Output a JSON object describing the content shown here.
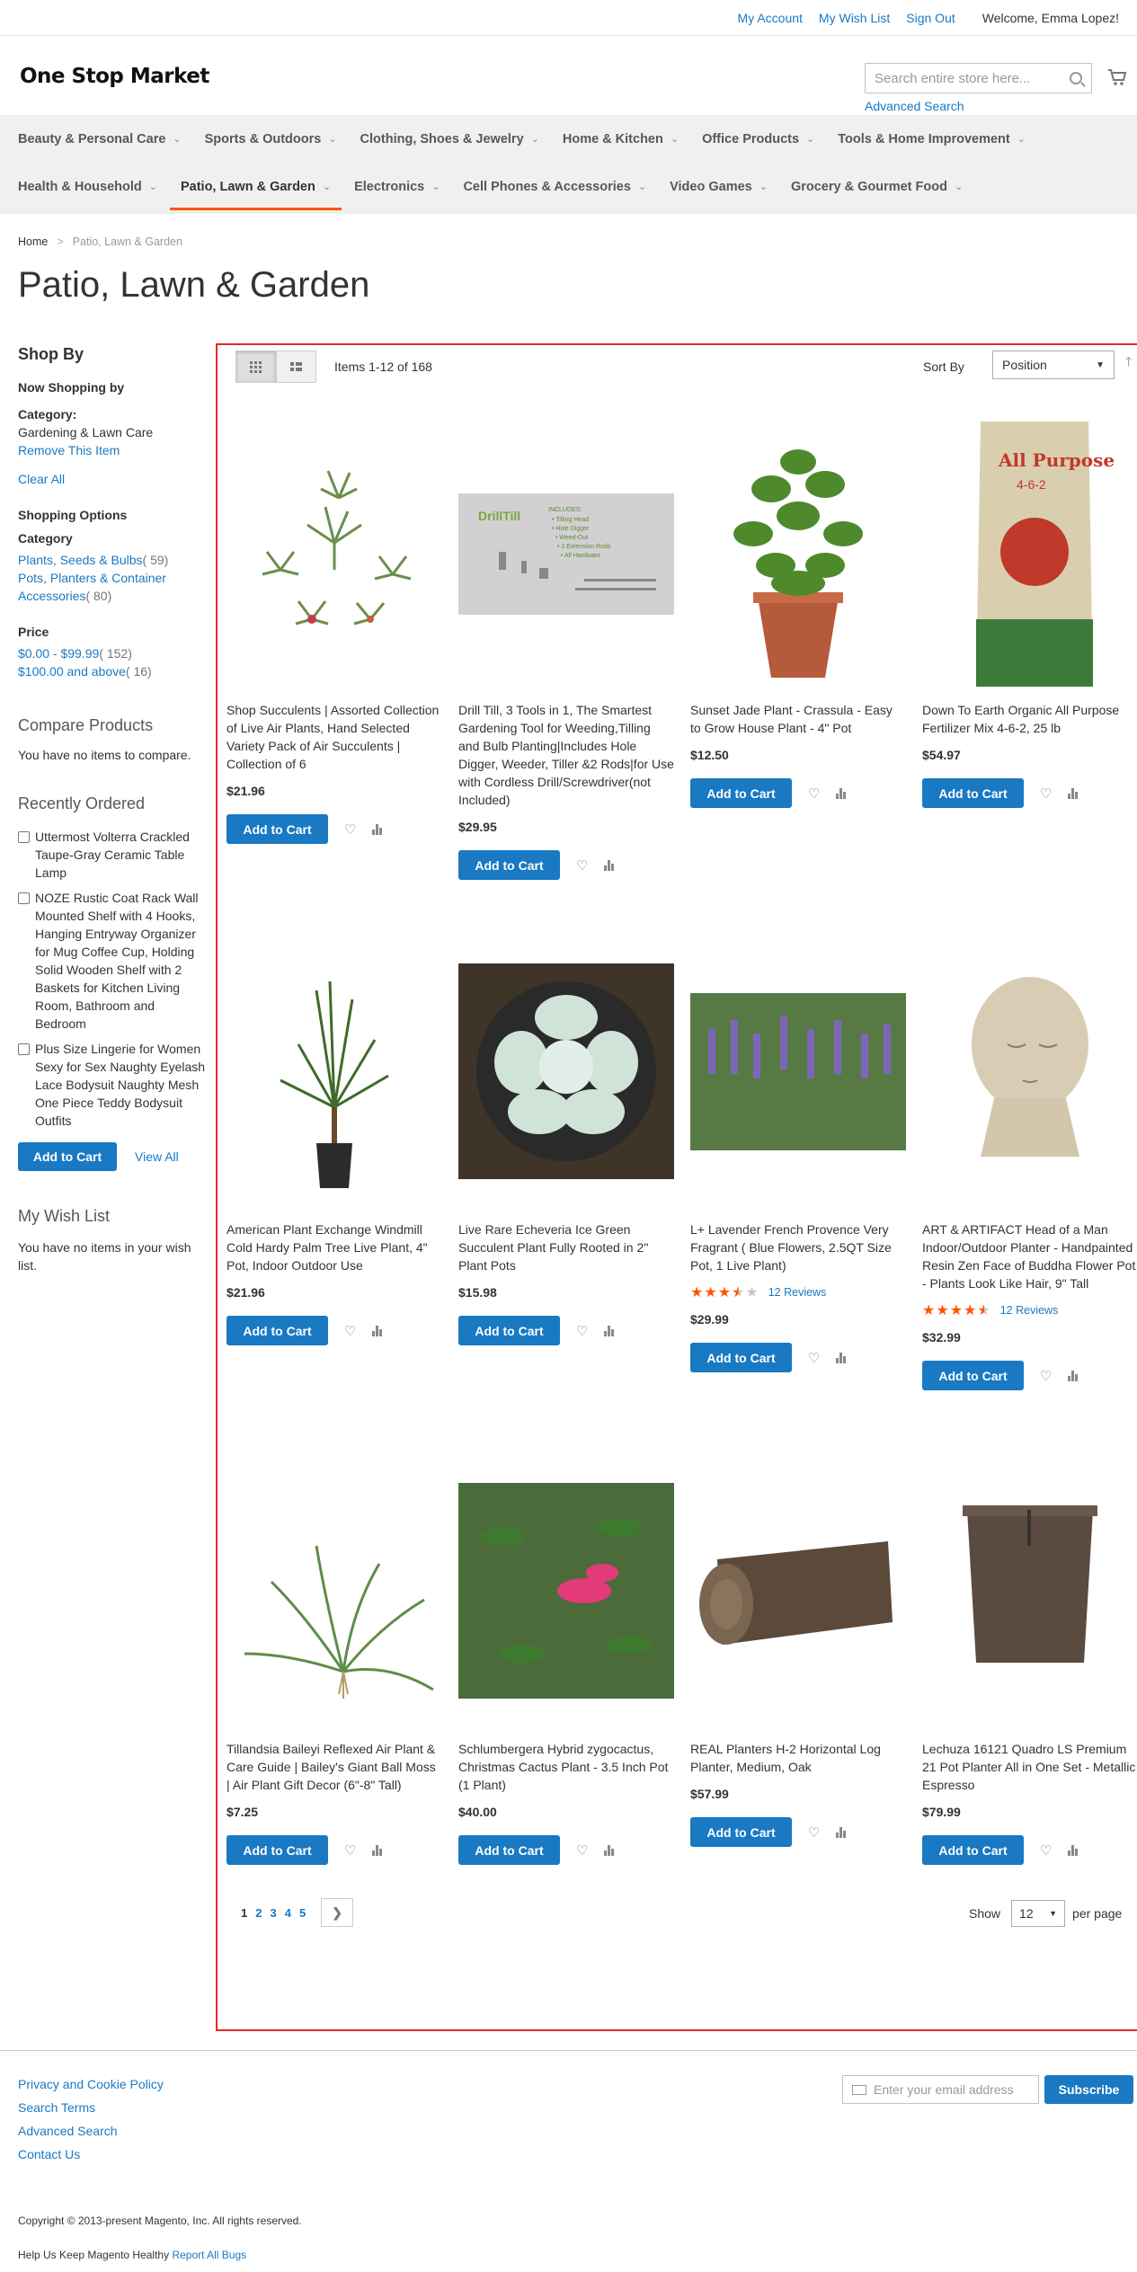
{
  "header": {
    "links": [
      "My Account",
      "My Wish List",
      "Sign Out"
    ],
    "welcome": "Welcome, Emma Lopez!",
    "logo": "One Stop Market",
    "search_placeholder": "Search entire store here...",
    "advanced_search": "Advanced Search"
  },
  "nav": {
    "row1": [
      "Beauty & Personal Care",
      "Sports & Outdoors",
      "Clothing, Shoes & Jewelry",
      "Home & Kitchen",
      "Office Products",
      "Tools & Home Improvement"
    ],
    "row2": [
      "Health & Household",
      "Patio, Lawn & Garden",
      "Electronics",
      "Cell Phones & Accessories",
      "Video Games",
      "Grocery & Gourmet Food"
    ],
    "active": "Patio, Lawn & Garden"
  },
  "breadcrumb": {
    "home": "Home",
    "current": "Patio, Lawn & Garden"
  },
  "page_title": "Patio, Lawn & Garden",
  "sidebar": {
    "shop_by": "Shop By",
    "now_shopping": "Now Shopping by",
    "category_label": "Category:",
    "category_value": "Gardening & Lawn Care",
    "remove_item": "Remove This Item",
    "clear_all": "Clear All",
    "shopping_options": "Shopping Options",
    "category_title": "Category",
    "categories": [
      {
        "name": "Plants, Seeds & Bulbs",
        "count": "( 59)"
      },
      {
        "name": "Pots, Planters & Container Accessories",
        "count": "( 80)"
      }
    ],
    "price_title": "Price",
    "prices": [
      {
        "name": "$0.00 - $99.99",
        "count": "( 152)"
      },
      {
        "name": "$100.00 and above",
        "count": "( 16)"
      }
    ],
    "compare_title": "Compare Products",
    "compare_empty": "You have no items to compare.",
    "recent_title": "Recently Ordered",
    "recent_items": [
      "Uttermost Volterra Crackled Taupe-Gray Ceramic Table Lamp",
      "NOZE Rustic Coat Rack Wall Mounted Shelf with 4 Hooks, Hanging Entryway Organizer for Mug Coffee Cup, Holding Solid Wooden Shelf with 2 Baskets for Kitchen Living Room, Bathroom and Bedroom",
      "Plus Size Lingerie for Women Sexy for Sex Naughty Eyelash Lace Bodysuit Naughty Mesh One Piece Teddy Bodysuit Outfits"
    ],
    "add_to_cart": "Add to Cart",
    "view_all": "View All",
    "wishlist_title": "My Wish List",
    "wishlist_empty": "You have no items in your wish list."
  },
  "toolbar": {
    "amount": "Items 1-12 of 168",
    "sort_by": "Sort By",
    "sort_value": "Position"
  },
  "products": [
    {
      "name": "Shop Succulents | Assorted Collection of Live Air Plants, Hand Selected Variety Pack of Air Succulents | Collection of 6",
      "price": "$21.96",
      "image": "air-plants-image"
    },
    {
      "name": "Drill Till, 3 Tools in 1, The Smartest Gardening Tool for Weeding,Tilling and Bulb Planting|Includes Hole Digger, Weeder, Tiller &2 Rods|for Use with Cordless Drill/Screwdriver(not Included)",
      "price": "$29.95",
      "image": "drill-till-image"
    },
    {
      "name": "Sunset Jade Plant - Crassula - Easy to Grow House Plant - 4\" Pot",
      "price": "$12.50",
      "image": "jade-plant-image"
    },
    {
      "name": "Down To Earth Organic All Purpose Fertilizer Mix 4-6-2, 25 lb",
      "price": "$54.97",
      "image": "fertilizer-bag-image"
    },
    {
      "name": "American Plant Exchange Windmill Cold Hardy Palm Tree Live Plant, 4\" Pot, Indoor Outdoor Use",
      "price": "$21.96",
      "image": "palm-tree-image"
    },
    {
      "name": "Live Rare Echeveria Ice Green Succulent Plant Fully Rooted in 2'' Plant Pots",
      "price": "$15.98",
      "image": "echeveria-image"
    },
    {
      "name": "L+ Lavender French Provence Very Fragrant ( Blue Flowers, 2.5QT Size Pot, 1 Live Plant)",
      "price": "$29.99",
      "rating": 3.5,
      "reviews": "12  Reviews",
      "image": "lavender-image"
    },
    {
      "name": "ART & ARTIFACT Head of a Man Indoor/Outdoor Planter - Handpainted Resin Zen Face of Buddha Flower Pot - Plants Look Like Hair, 9\" Tall",
      "price": "$32.99",
      "rating": 4.5,
      "reviews": "12  Reviews",
      "image": "head-planter-image"
    },
    {
      "name": "Tillandsia Baileyi Reflexed Air Plant & Care Guide | Bailey's Giant Ball Moss | Air Plant Gift Decor (6\"-8\" Tall)",
      "price": "$7.25",
      "image": "tillandsia-image"
    },
    {
      "name": "Schlumbergera Hybrid zygocactus, Christmas Cactus Plant - 3.5 Inch Pot (1 Plant)",
      "price": "$40.00",
      "image": "christmas-cactus-image"
    },
    {
      "name": "REAL Planters H-2 Horizontal Log Planter, Medium, Oak",
      "price": "$57.99",
      "image": "log-planter-image"
    },
    {
      "name": "Lechuza 16121 Quadro LS Premium 21 Pot Planter All in One Set - Metallic Espresso",
      "price": "$79.99",
      "image": "quadro-planter-image"
    }
  ],
  "product_button": "Add to Cart",
  "pager": {
    "pages": [
      "1",
      "2",
      "3",
      "4",
      "5"
    ],
    "current": "1"
  },
  "limiter": {
    "show": "Show",
    "value": "12",
    "per_page": "per page"
  },
  "footer": {
    "links": [
      "Privacy and Cookie Policy",
      "Search Terms",
      "Advanced Search",
      "Contact Us"
    ],
    "newsletter_placeholder": "Enter your email address",
    "subscribe": "Subscribe",
    "copyright": "Copyright © 2013-present Magento, Inc. All rights reserved.",
    "help_text": "Help Us Keep Magento Healthy",
    "report_bugs": "Report All Bugs"
  },
  "colors": {
    "accent": "#1979c3",
    "active_nav": "#ff5501",
    "highlight_border": "#e02b27",
    "star": "#ff5501"
  }
}
